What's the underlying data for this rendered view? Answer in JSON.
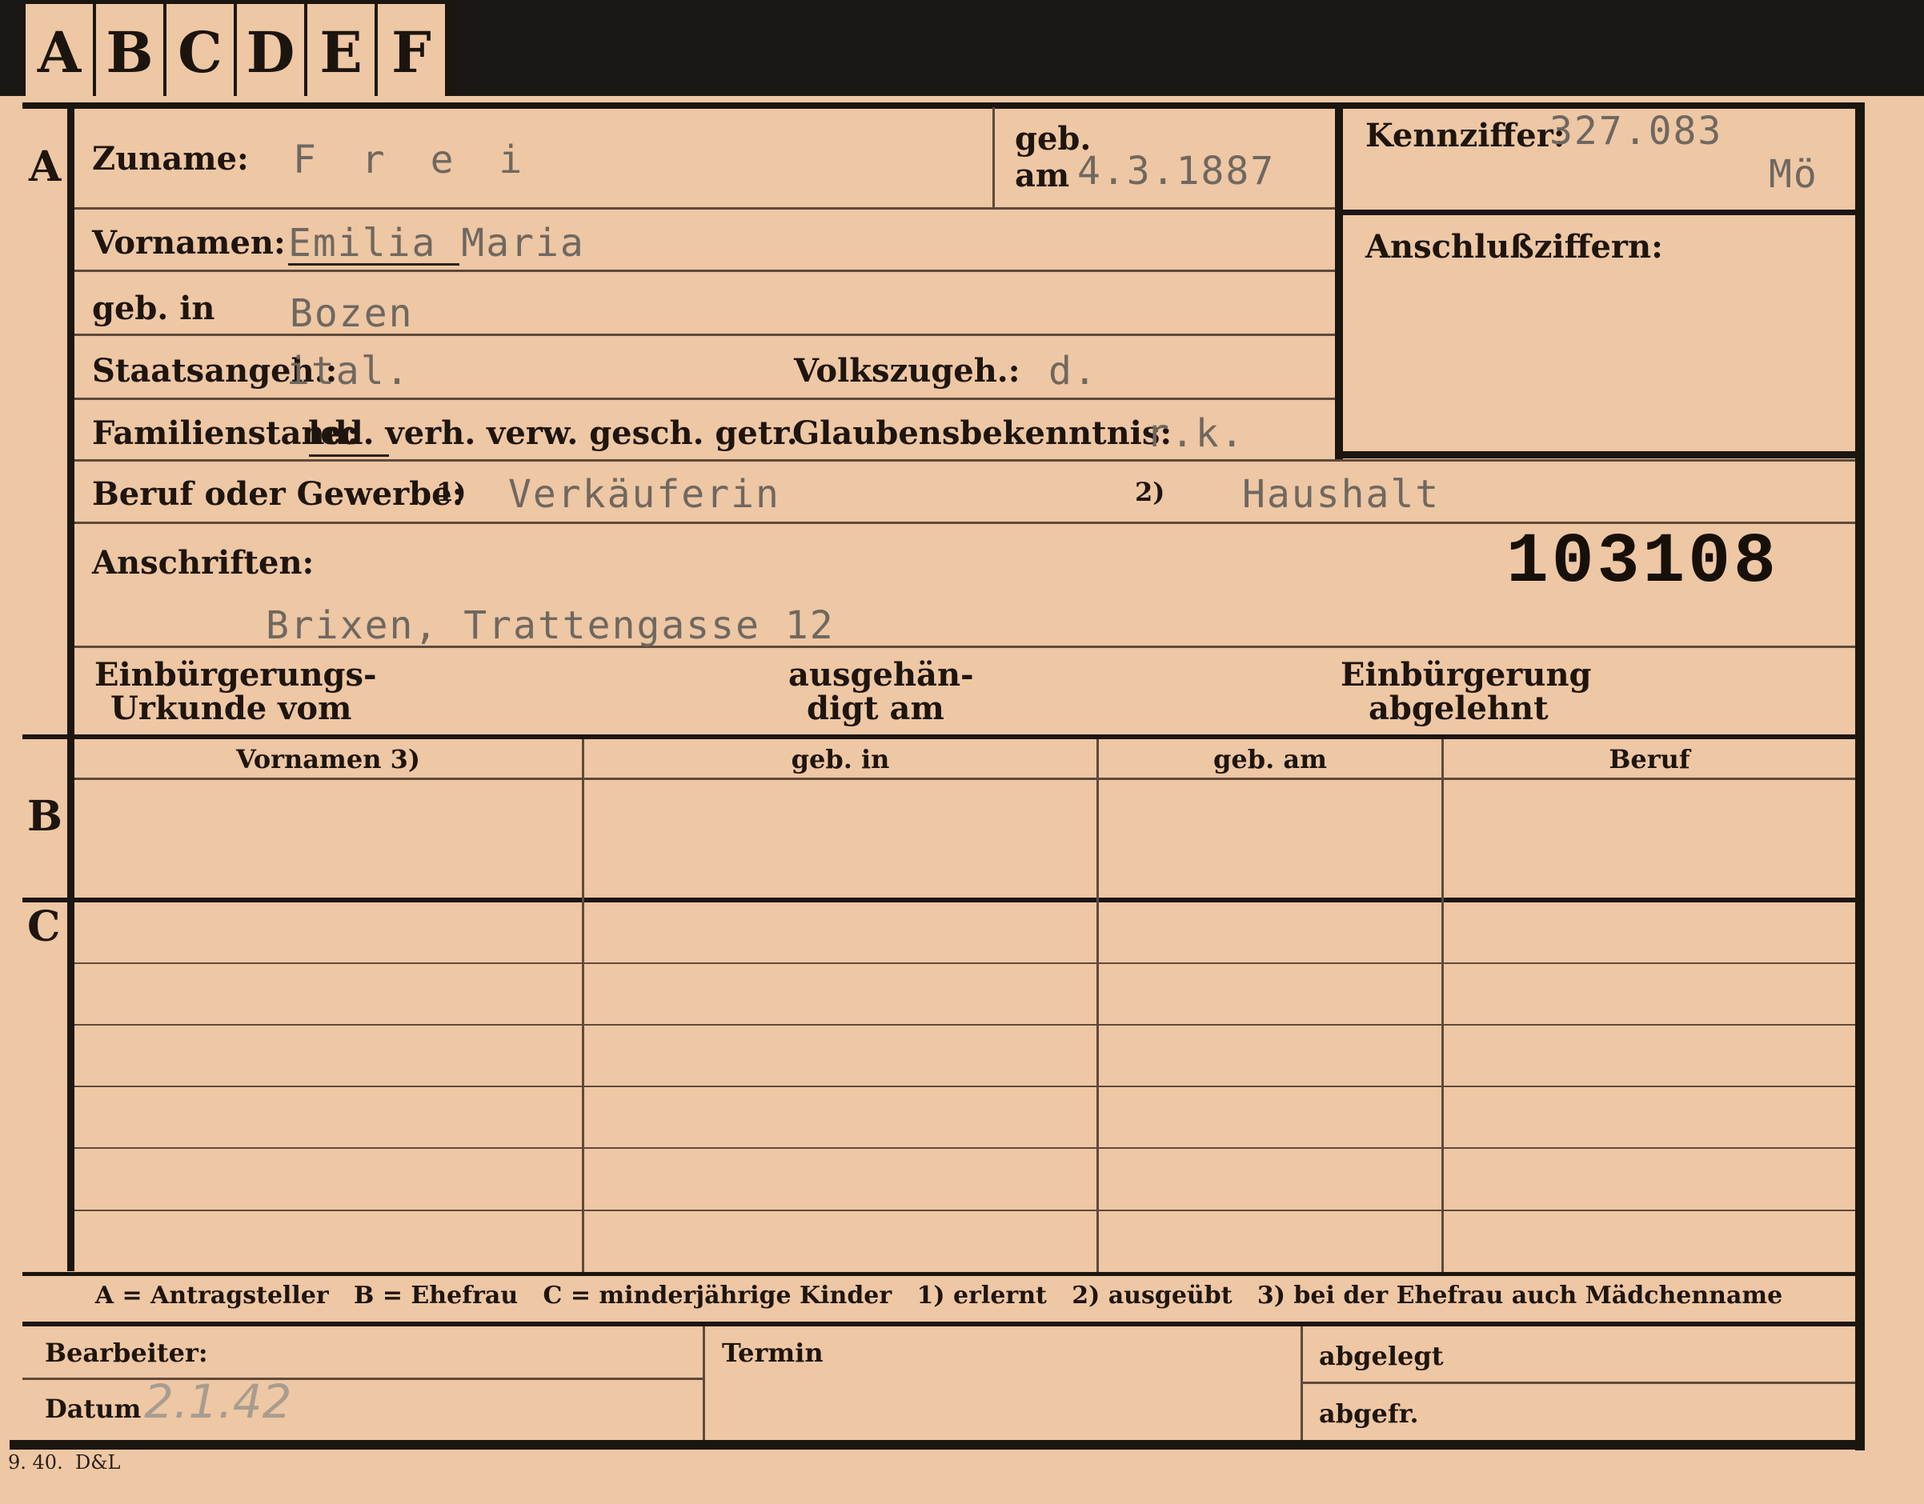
{
  "tabs": [
    "A",
    "B",
    "C",
    "D",
    "E",
    "F"
  ],
  "sections": {
    "a": "A",
    "b": "B",
    "c": "C"
  },
  "labels": {
    "zuname": "Zuname:",
    "geb": "geb.",
    "am": "am",
    "kennziffer": "Kennziffer:",
    "vornamen": "Vornamen:",
    "anschlussziffern": "Anschlußziffern:",
    "geb_in": "geb. in",
    "staatsangeh": "Staatsangeh.:",
    "volkszugeh": "Volkszugeh.:",
    "familienstand": "Familienstand:",
    "familienstand_options": "led. verh. verw. gesch. getr.",
    "glaubensbekenntnis": "Glaubensbekenntnis:",
    "beruf": "Beruf oder Gewerbe:",
    "fn1": "1)",
    "fn2": "2)",
    "anschriften": "Anschriften:",
    "einbuergerung_line1": "Einbürgerungs-",
    "einbuergerung_line2": "Urkunde vom",
    "ausgehaendigt_line1": "ausgehän-",
    "ausgehaendigt_line2": "digt am",
    "abgelehnt_line1": "Einbürgerung",
    "abgelehnt_line2": "abgelehnt",
    "bearbeiter": "Bearbeiter:",
    "datum": "Datum",
    "termin": "Termin",
    "abgelegt": "abgelegt",
    "abgefr": "abgefr."
  },
  "table": {
    "columns": [
      "Vornamen 3)",
      "geb. in",
      "geb. am",
      "Beruf"
    ]
  },
  "legend": "A = Antragsteller   B = Ehefrau   C = minderjährige Kinder   1) erlernt   2) ausgeübt   3) bei der Ehefrau auch Mädchenname",
  "values": {
    "zuname": "F r e i",
    "geburtsdatum": "4.3.1887",
    "kennziffer": "327.083",
    "kennziffer_suffix": "Mö",
    "vornamen": "Emilia Maria",
    "geburtsort": "Bozen",
    "staatsangehoerigkeit": "ital.",
    "volkszugehoerigkeit": "d.",
    "glaubensbekenntnis": "r.k.",
    "beruf_erlernt": "Verkäuferin",
    "beruf_ausgeuebt": "Haushalt",
    "nummer": "103108",
    "anschrift": "Brixen, Trattengasse 12",
    "datum": "2.1.42"
  },
  "footer_print": "9. 40.  D&L"
}
